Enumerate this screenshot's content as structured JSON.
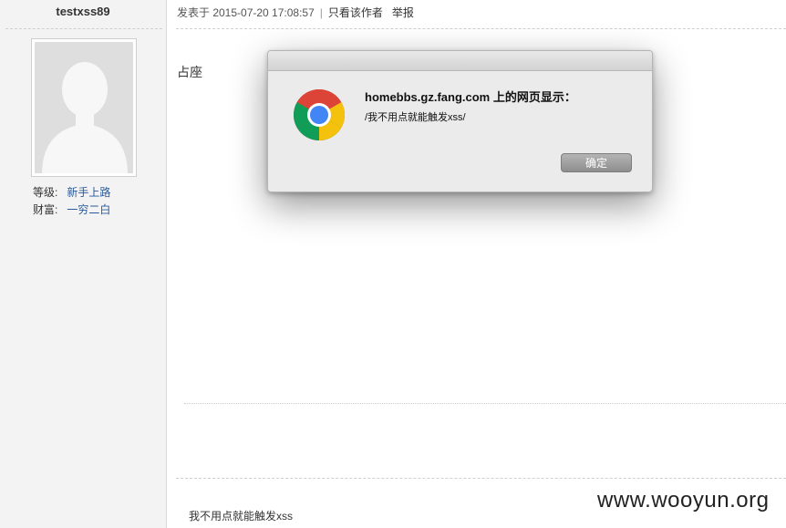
{
  "author": {
    "username": "testxss89",
    "level_label": "等级:",
    "level_value": "新手上路",
    "wealth_label": "财富:",
    "wealth_value": "一穷二白"
  },
  "post": {
    "posted_at": "发表于 2015-07-20 17:08:57",
    "separator": "|",
    "only_author_label": "只看该作者",
    "report_label": "举报",
    "body": "占座",
    "signature": "我不用点就能触发xss"
  },
  "dialog": {
    "title": "homebbs.gz.fang.com 上的网页显示：",
    "message": "/我不用点就能触发xss/",
    "ok_label": "确定"
  },
  "watermark": "www.wooyun.org",
  "colors": {
    "sidebar_bg": "#f3f3f3",
    "link_blue": "#2a5a9b",
    "dialog_bg": "#ebebeb",
    "ok_button": "#9c9c9c"
  },
  "icons": {
    "avatar": "default-avatar-silhouette",
    "dialog_logo": "chrome-logo-icon"
  }
}
